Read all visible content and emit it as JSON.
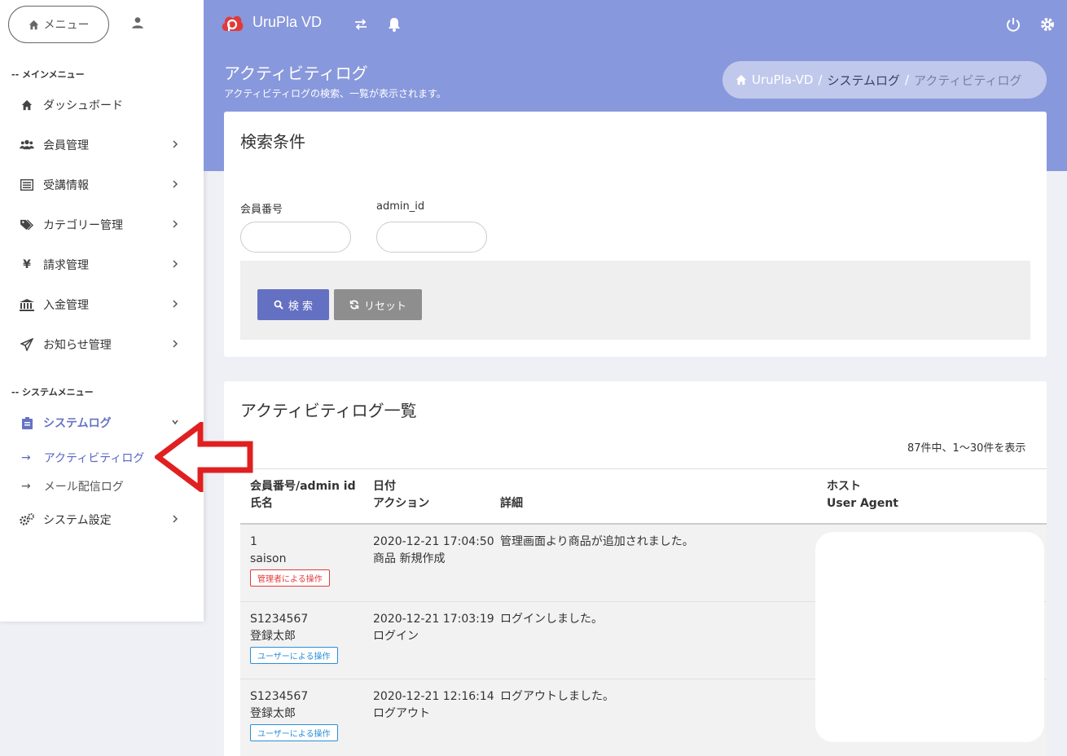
{
  "sidebar": {
    "menu_button": "メニュー",
    "main_menu_label": "-- メインメニュー",
    "system_menu_label": "-- システムメニュー",
    "items": [
      {
        "label": "ダッシュボード"
      },
      {
        "label": "会員管理"
      },
      {
        "label": "受講情報"
      },
      {
        "label": "カテゴリー管理"
      },
      {
        "label": "請求管理"
      },
      {
        "label": "入金管理"
      },
      {
        "label": "お知らせ管理"
      }
    ],
    "system_items": [
      {
        "label": "システムログ"
      },
      {
        "label": "システム設定"
      }
    ],
    "sub_items": [
      {
        "arrow": "→",
        "label": "アクティビティログ"
      },
      {
        "arrow": "→",
        "label": "メール配信ログ"
      }
    ]
  },
  "topbar": {
    "brand": "UruPla VD"
  },
  "header": {
    "title": "アクティビティログ",
    "subtitle": "アクティビティログの検索、一覧が表示されます。",
    "breadcrumb": [
      "UruPla-VD",
      "システムログ",
      "アクティビティログ"
    ],
    "breadcrumb_sep": "/"
  },
  "search": {
    "title": "検索条件",
    "field1_label": "会員番号",
    "field2_label": "admin_id",
    "search_button": "検 索",
    "reset_button": "リセット"
  },
  "list": {
    "title": "アクティビティログ一覧",
    "count_text": "87件中、1〜30件を表示",
    "headers": {
      "col1_line1": "会員番号/admin id",
      "col1_line2": "氏名",
      "col2_line1": "日付",
      "col2_line2": "アクション",
      "col3": "詳細",
      "col4_line1": "ホスト",
      "col4_line2": "User Agent"
    },
    "rows": [
      {
        "id": "1",
        "name": "saison",
        "badge": "管理者による操作",
        "date": "2020-12-21 17:04:50",
        "action": "商品 新規作成",
        "detail": "管理画面より商品が追加されました。"
      },
      {
        "id": "S1234567",
        "name": "登録太郎",
        "badge": "ユーザーによる操作",
        "date": "2020-12-21 17:03:19",
        "action": "ログイン",
        "detail": "ログインしました。"
      },
      {
        "id": "S1234567",
        "name": "登録太郎",
        "badge": "ユーザーによる操作",
        "date": "2020-12-21 12:16:14",
        "action": "ログアウト",
        "detail": "ログアウトしました。"
      }
    ]
  },
  "colors": {
    "accent": "#8898dc",
    "primary_button": "#6470c2",
    "arrow": "#e02020"
  }
}
